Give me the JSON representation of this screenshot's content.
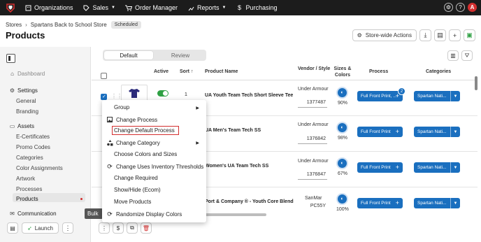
{
  "nav": {
    "items": [
      {
        "label": "Organizations",
        "icon": "building-icon",
        "caret": false
      },
      {
        "label": "Sales",
        "icon": "tag-icon",
        "caret": true
      },
      {
        "label": "Order Manager",
        "icon": "cart-icon",
        "caret": false
      },
      {
        "label": "Reports",
        "icon": "chart-icon",
        "caret": true
      },
      {
        "label": "Purchasing",
        "icon": "dollar-icon",
        "caret": false
      }
    ],
    "help": "?",
    "avatar": "A"
  },
  "breadcrumb": {
    "root": "Stores",
    "store": "Spartans Back to School Store",
    "status_badge": "Scheduled"
  },
  "page": {
    "title": "Products",
    "storewide_label": "Store-wide Actions"
  },
  "sidebar": {
    "dashboard": "Dashboard",
    "settings": "Settings",
    "general": "General",
    "branding": "Branding",
    "assets": "Assets",
    "asset_items": [
      "E-Certificates",
      "Promo Codes",
      "Categories",
      "Color Assignments",
      "Artwork",
      "Processes",
      "Products"
    ],
    "communication": "Communication",
    "launch": "Launch"
  },
  "view_toggle": {
    "selected": "Default",
    "other": "Review"
  },
  "table": {
    "headers": {
      "active": "Active",
      "sort": "Sort",
      "product_name": "Product Name",
      "vendor_style": "Vendor / Style",
      "sizes_colors": "Sizes & Colors",
      "process": "Process",
      "categories": "Categories"
    },
    "rows": [
      {
        "sort": "1",
        "name": "UA Youth Team Tech Short Sleeve Tee",
        "vendor": "Under Armour",
        "style": "1377487",
        "pct": "90%",
        "process": "Full Front Print, ...",
        "process_count": "2",
        "category": "Spartan Nati..."
      },
      {
        "sort": "",
        "name": "UA Men's Team Tech SS",
        "vendor": "Under Armour",
        "style": "1376842",
        "pct": "98%",
        "process": "Full Front Print",
        "process_count": "",
        "category": "Spartan Nati..."
      },
      {
        "sort": "",
        "name": "Women's UA Team Tech SS",
        "vendor": "Under Armour",
        "style": "1376847",
        "pct": "67%",
        "process": "Full Front Print",
        "process_count": "",
        "category": "Spartan Nati..."
      },
      {
        "sort": "",
        "name": "Port & Company ® - Youth Core Blend",
        "vendor": "SanMar",
        "style": "PC55Y",
        "pct": "100%",
        "process": "Full Front Print",
        "process_count": "",
        "category": "Spartan Nati..."
      }
    ]
  },
  "context_menu": {
    "items": [
      "Group",
      "Change Process",
      "Change Default Process",
      "Change Category",
      "Choose Colors and Sizes",
      "Change Uses Inventory Thresholds",
      "Change Required",
      "Show/Hide (Ecom)",
      "Move Products",
      "Randomize Display Colors"
    ]
  },
  "tooltip": "Bulk",
  "colors": {
    "primary": "#1a6fbf",
    "nav_bg": "#1c1c1c",
    "active_toggle": "#2ea043",
    "highlight": "#d32f2f"
  }
}
